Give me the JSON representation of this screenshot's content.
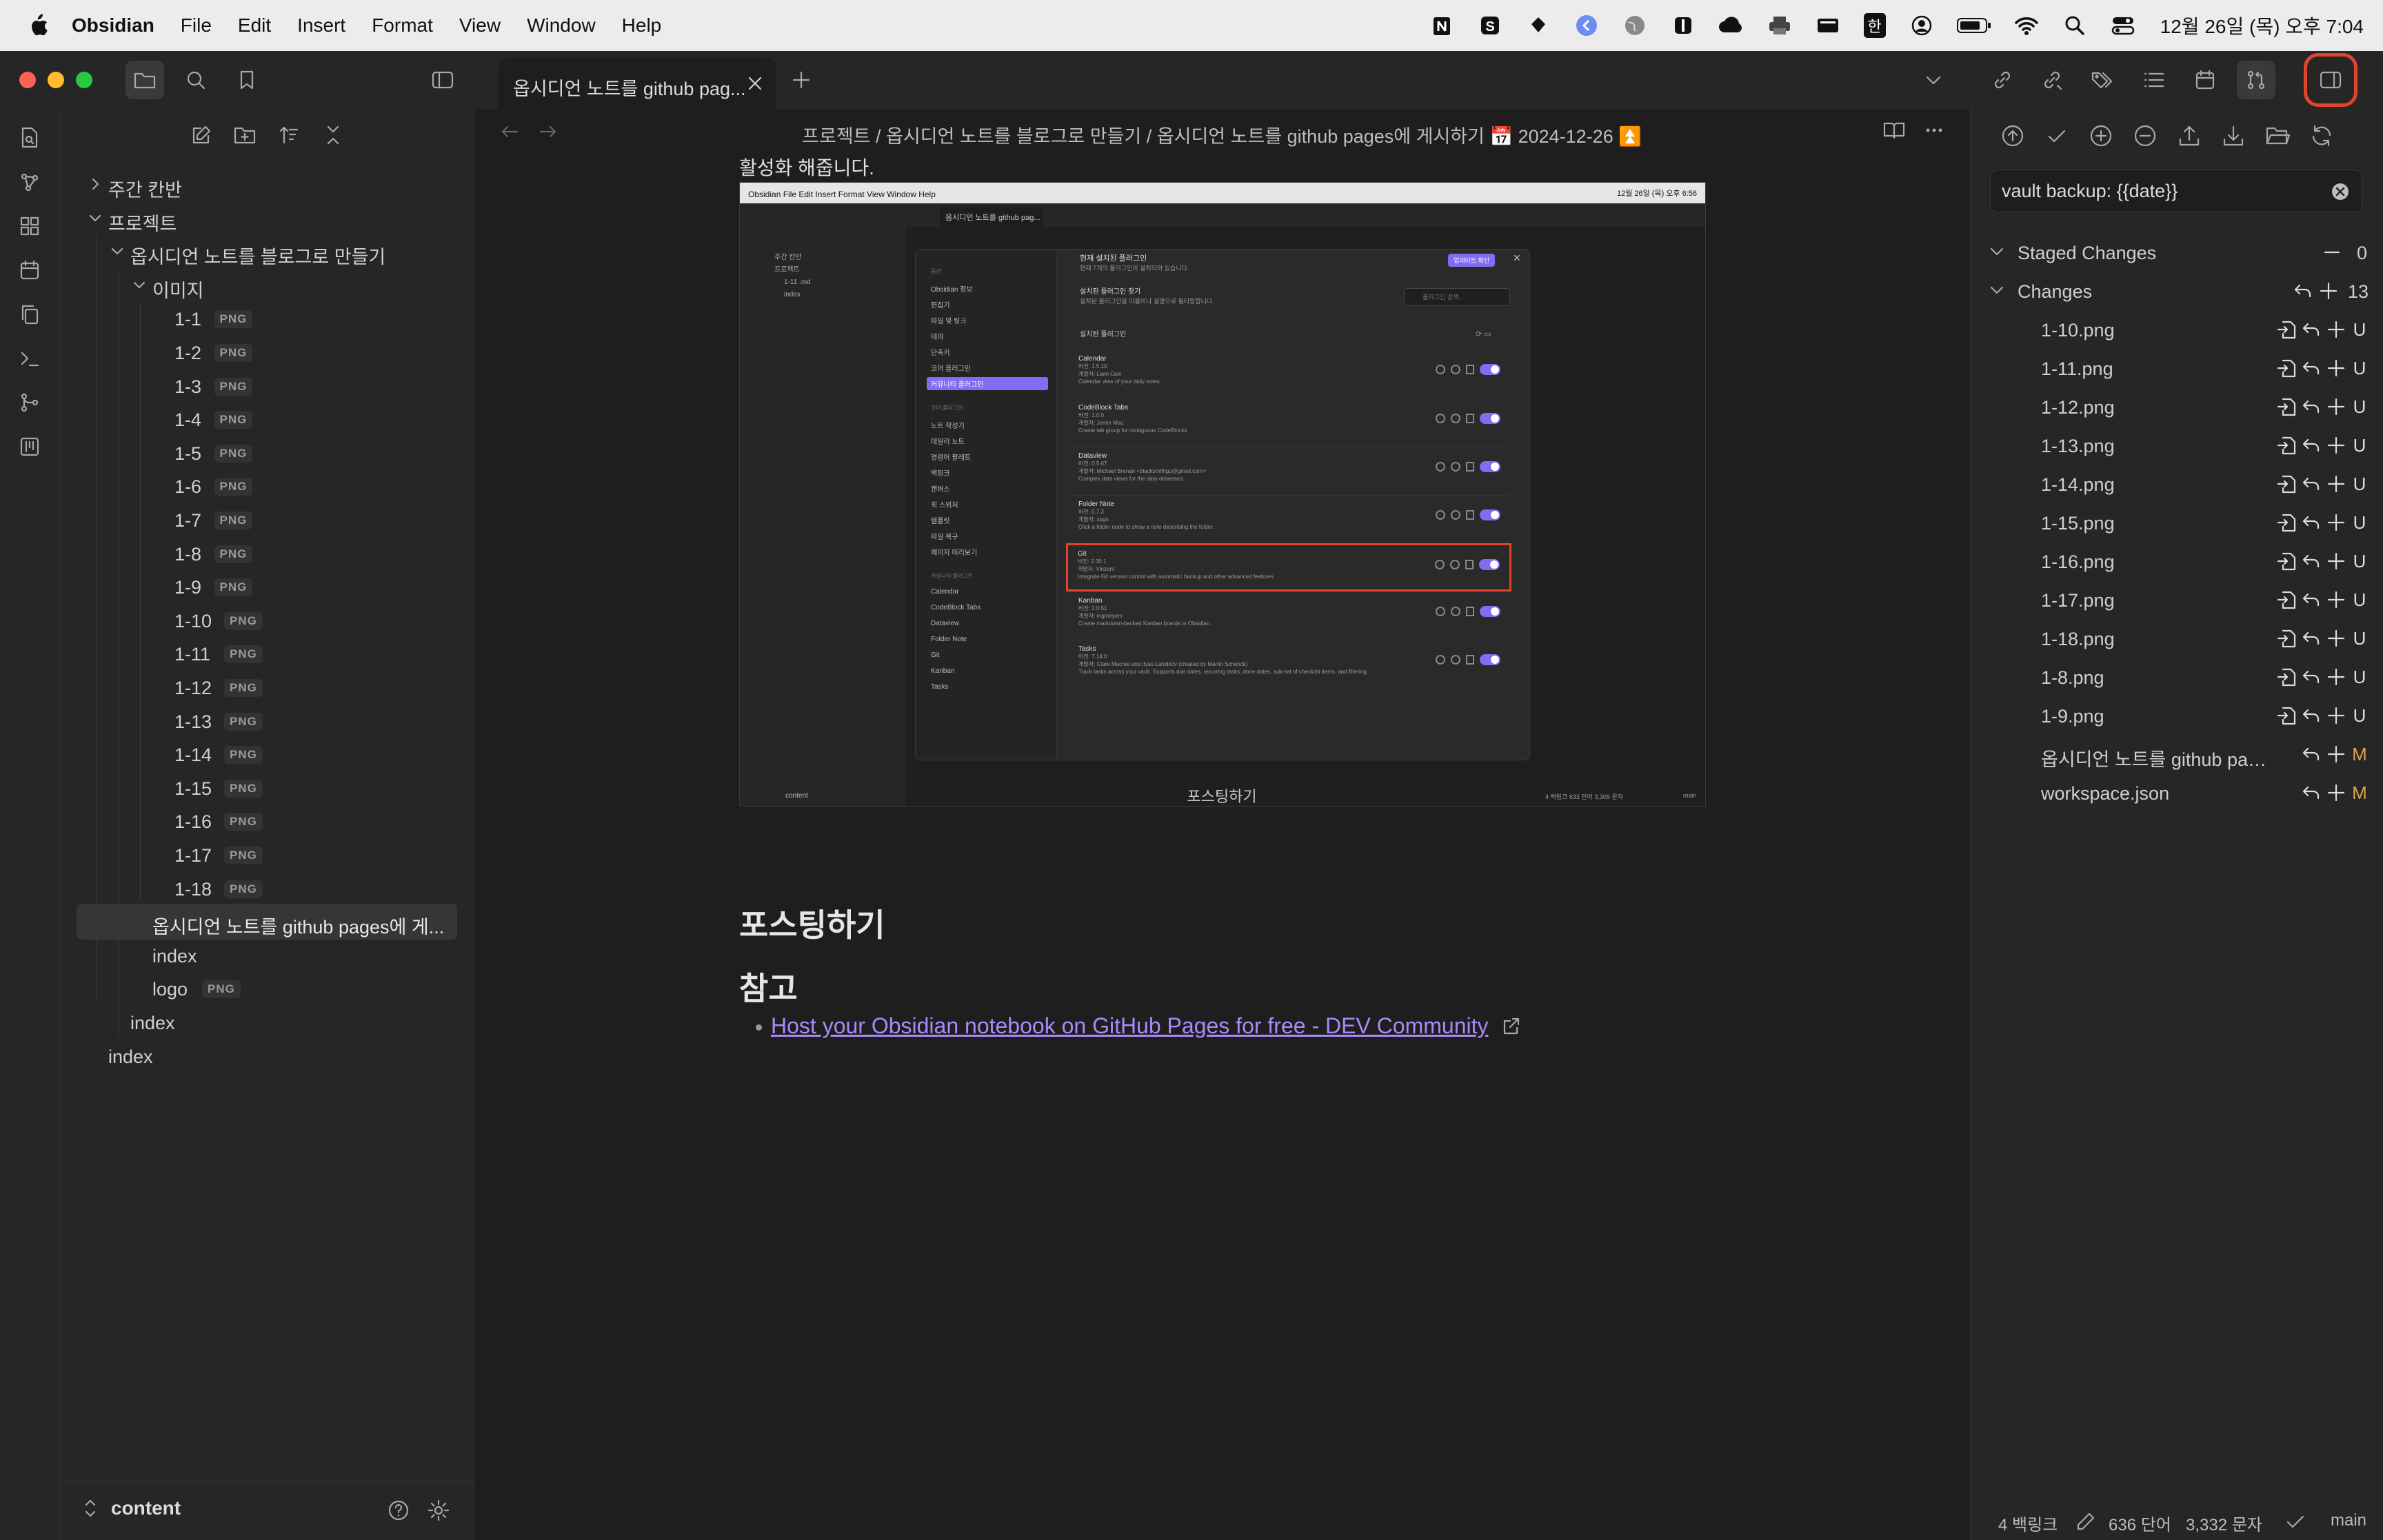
{
  "menubar": {
    "app": "Obsidian",
    "menus": [
      "File",
      "Edit",
      "Insert",
      "Format",
      "View",
      "Window",
      "Help"
    ],
    "clock": "12월 26일 (목) 오후 7:04",
    "ime": "한"
  },
  "tab": {
    "title": "옵시디언 노트를 github pag..."
  },
  "editor": {
    "breadcrumb": "프로젝트 / 옵시디언 노트를 블로그로 만들기 / 옵시디언 노트를 github pages에 게시하기 📅 2024-12-26 ⏫",
    "top_text": "활성화 해줍니다.",
    "image_caption": "포스팅하기",
    "heading_posting": "포스팅하기",
    "heading_reference": "참고",
    "reference_link": "Host your Obsidian notebook on GitHub Pages for free - DEV Community"
  },
  "explorer": {
    "items": [
      {
        "label": "주간 칸반",
        "depth": 0,
        "folder": true,
        "open": false
      },
      {
        "label": "프로젝트",
        "depth": 0,
        "folder": true,
        "open": true
      },
      {
        "label": "옵시디언 노트를 블로그로 만들기",
        "depth": 1,
        "folder": true,
        "open": true
      },
      {
        "label": "이미지",
        "depth": 2,
        "folder": true,
        "open": true
      },
      {
        "label": "1-1",
        "depth": 3,
        "badge": "PNG"
      },
      {
        "label": "1-2",
        "depth": 3,
        "badge": "PNG"
      },
      {
        "label": "1-3",
        "depth": 3,
        "badge": "PNG"
      },
      {
        "label": "1-4",
        "depth": 3,
        "badge": "PNG"
      },
      {
        "label": "1-5",
        "depth": 3,
        "badge": "PNG"
      },
      {
        "label": "1-6",
        "depth": 3,
        "badge": "PNG"
      },
      {
        "label": "1-7",
        "depth": 3,
        "badge": "PNG"
      },
      {
        "label": "1-8",
        "depth": 3,
        "badge": "PNG"
      },
      {
        "label": "1-9",
        "depth": 3,
        "badge": "PNG"
      },
      {
        "label": "1-10",
        "depth": 3,
        "badge": "PNG"
      },
      {
        "label": "1-11",
        "depth": 3,
        "badge": "PNG"
      },
      {
        "label": "1-12",
        "depth": 3,
        "badge": "PNG"
      },
      {
        "label": "1-13",
        "depth": 3,
        "badge": "PNG"
      },
      {
        "label": "1-14",
        "depth": 3,
        "badge": "PNG"
      },
      {
        "label": "1-15",
        "depth": 3,
        "badge": "PNG"
      },
      {
        "label": "1-16",
        "depth": 3,
        "badge": "PNG"
      },
      {
        "label": "1-17",
        "depth": 3,
        "badge": "PNG"
      },
      {
        "label": "1-18",
        "depth": 3,
        "badge": "PNG"
      },
      {
        "label": "옵시디언 노트를 github pages에 게...",
        "depth": 2,
        "active": true
      },
      {
        "label": "index",
        "depth": 2
      },
      {
        "label": "logo",
        "depth": 2,
        "badge": "PNG"
      },
      {
        "label": "index",
        "depth": 1
      },
      {
        "label": "index",
        "depth": 0
      }
    ],
    "vault_name": "content"
  },
  "git": {
    "commit_message": "vault backup: {{date}}",
    "staged_label": "Staged Changes",
    "staged_count": "0",
    "changes_label": "Changes",
    "changes_count": "13",
    "files": [
      {
        "name": "1-10.png",
        "status": "U"
      },
      {
        "name": "1-11.png",
        "status": "U"
      },
      {
        "name": "1-12.png",
        "status": "U"
      },
      {
        "name": "1-13.png",
        "status": "U"
      },
      {
        "name": "1-14.png",
        "status": "U"
      },
      {
        "name": "1-15.png",
        "status": "U"
      },
      {
        "name": "1-16.png",
        "status": "U"
      },
      {
        "name": "1-17.png",
        "status": "U"
      },
      {
        "name": "1-18.png",
        "status": "U"
      },
      {
        "name": "1-8.png",
        "status": "U"
      },
      {
        "name": "1-9.png",
        "status": "U"
      },
      {
        "name": "옵시디언 노트를 github pag...",
        "status": "M"
      },
      {
        "name": "workspace.json",
        "status": "M"
      }
    ],
    "status_colors": {
      "U": "#dcdcdc",
      "M": "#e0a14a"
    }
  },
  "statusbar": {
    "backlinks": "4 백링크",
    "words": "636 단어",
    "chars": "3,332 문자",
    "branch": "main"
  },
  "embedded": {
    "window_title": "옵시디언 노트를 github pag...",
    "modal_title": "현재 설치된 플러그인",
    "modal_sub": "현재 7개의 플러그인이 설치되어 있습니다.",
    "update_btn": "업데이트 확인",
    "search_title": "설치된 플러그인 찾기",
    "search_sub": "설치된 플러그인을 이름이나 설명으로 필터링합니다.",
    "search_placeholder": "플러그인 검색...",
    "installed_header": "설치된 플러그인",
    "sidebar_opts": [
      "옵션",
      "Obsidian 정보",
      "편집기",
      "파일 및 링크",
      "테마",
      "단축키",
      "코어 플러그인",
      "커뮤니티 플러그인"
    ],
    "core_header": "코어 플러그인",
    "core_items": [
      "노트 작성기",
      "데일리 노트",
      "명령어 팔레트",
      "백링크",
      "캔버스",
      "퀵 스위처",
      "템플릿",
      "파일 복구",
      "페이지 미리보기"
    ],
    "community_header": "커뮤니티 플러그인",
    "community_items": [
      "Calendar",
      "CodeBlock Tabs",
      "Dataview",
      "Folder Note",
      "Git",
      "Kanban",
      "Tasks"
    ],
    "plugins": [
      {
        "name": "Calendar",
        "version": "버전: 1.5.10",
        "author": "개발자: Liam Cain",
        "desc": "Calendar view of your daily notes"
      },
      {
        "name": "CodeBlock Tabs",
        "version": "버전: 1.0.0",
        "author": "개발자: Jemin Mac",
        "desc": "Create tab group for contiguous CodeBlocks."
      },
      {
        "name": "Dataview",
        "version": "버전: 0.5.67",
        "author": "개발자: Michael Brenan <blacksmithgu@gmail.com>",
        "desc": "Complex data views for the data-obsessed."
      },
      {
        "name": "Folder Note",
        "version": "버전: 0.7.3",
        "author": "개발자: xpgo",
        "desc": "Click a folder node to show a note describing the folder."
      },
      {
        "name": "Git",
        "version": "버전: 2.30.1",
        "author": "개발자: Vinzent",
        "desc": "Integrate Git version control with automatic backup and other advanced features.",
        "highlight": true
      },
      {
        "name": "Kanban",
        "version": "버전: 2.0.51",
        "author": "개발자: mgmeyers",
        "desc": "Create markdown-backed Kanban boards in Obsidian."
      },
      {
        "name": "Tasks",
        "version": "버전: 7.14.0",
        "author": "개발자: Clare Macrae and Ilyas Landikov (created by Martin Schenck)",
        "desc": "Track tasks across your vault. Supports due dates, recurring tasks, done dates, sub-set of checklist items, and filtering."
      }
    ],
    "mini_tree": [
      "주간 칸반",
      "프로젝트",
      "1-11 .md",
      "index"
    ],
    "mini_vault": "content",
    "mini_status": "4 백링크   633 단어   3,309 문자",
    "mini_branch": "main",
    "mini_clock": "12월 26일 (목) 오후 6:56"
  },
  "colors": {
    "accent": "#7f6df2",
    "link": "#a88bfa",
    "highlight_box": "#e0442b",
    "modified": "#e0a14a"
  }
}
